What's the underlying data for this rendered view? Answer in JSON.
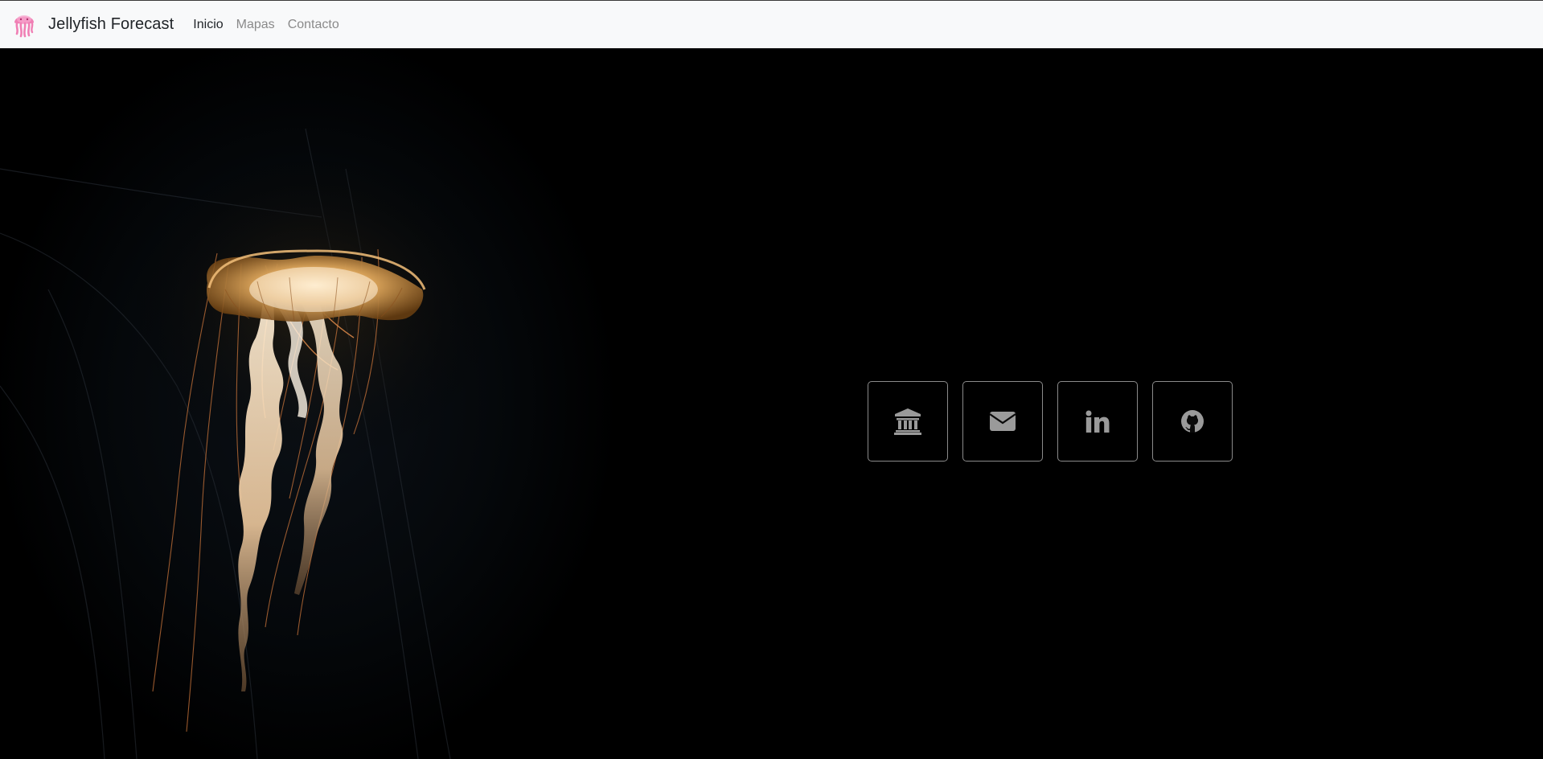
{
  "navbar": {
    "brand": "Jellyfish Forecast",
    "logo_icon": "jellyfish-icon",
    "links": [
      {
        "label": "Inicio",
        "active": true
      },
      {
        "label": "Mapas",
        "active": false
      },
      {
        "label": "Contacto",
        "active": false
      }
    ]
  },
  "hero": {
    "image": "jellyfish-photo",
    "social_links": [
      {
        "icon": "institution-icon"
      },
      {
        "icon": "envelope-icon"
      },
      {
        "icon": "linkedin-icon"
      },
      {
        "icon": "github-icon"
      }
    ]
  },
  "colors": {
    "navbar_bg": "#f8f9fa",
    "hero_bg": "#000000",
    "icon_gray": "#9a9a9a",
    "logo_pink": "#f07fb4"
  }
}
